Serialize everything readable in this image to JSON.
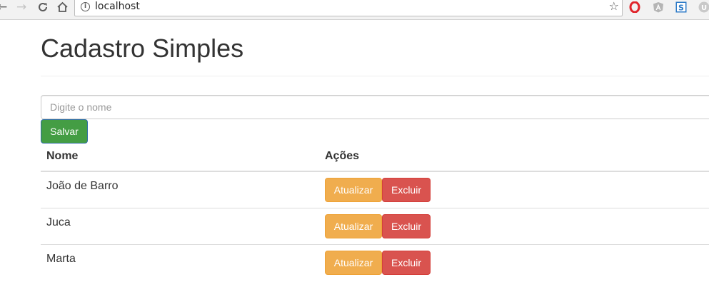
{
  "browser": {
    "url": "localhost",
    "nav": {
      "back_icon": "arrow-left-icon",
      "forward_icon": "arrow-right-icon",
      "reload_icon": "reload-icon",
      "home_icon": "home-icon"
    },
    "extensions": [
      "opera-icon",
      "angular-icon",
      "s-extension-icon",
      "u-extension-icon"
    ],
    "ext_u_letter": "U",
    "ext_s_letter": "S"
  },
  "page": {
    "title": "Cadastro Simples",
    "input_placeholder": "Digite o nome",
    "input_value": "",
    "save_label": "Salvar"
  },
  "table": {
    "headers": {
      "name": "Nome",
      "actions": "Ações"
    },
    "rows": [
      {
        "name": "João de Barro",
        "update_label": "Atualizar",
        "delete_label": "Excluir"
      },
      {
        "name": "Juca",
        "update_label": "Atualizar",
        "delete_label": "Excluir"
      },
      {
        "name": "Marta",
        "update_label": "Atualizar",
        "delete_label": "Excluir"
      }
    ]
  },
  "colors": {
    "save": "#449d44",
    "update": "#f0ad4e",
    "delete": "#d9534f",
    "text": "#333333"
  }
}
